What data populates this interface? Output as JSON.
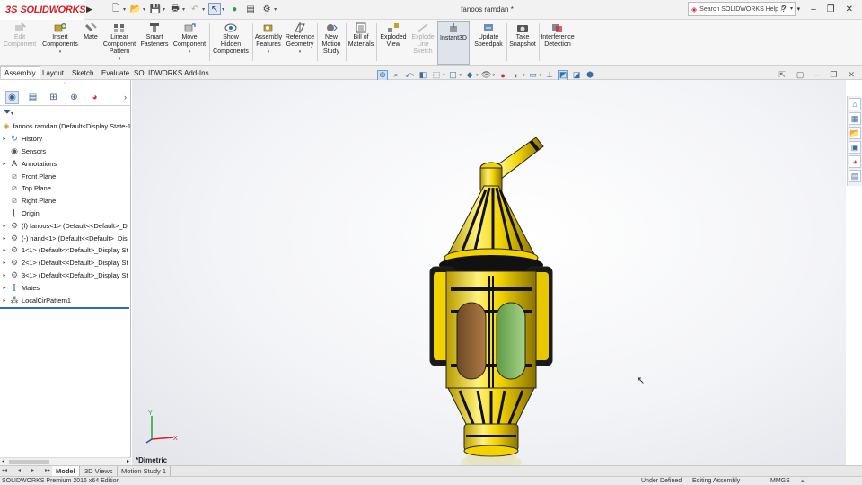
{
  "app": {
    "logo_ds": "3S",
    "logo_text": "SOLIDWORKS",
    "document_title": "fanoos ramdan *",
    "help_search_placeholder": "Search SOLIDWORKS Help"
  },
  "command_manager": [
    {
      "label": "Edit\nComponent",
      "enabled": false,
      "icon": "edit-component-icon"
    },
    {
      "label": "Insert\nComponents",
      "enabled": true,
      "icon": "insert-components-icon",
      "dropdown": true
    },
    {
      "label": "Mate",
      "enabled": true,
      "icon": "mate-icon"
    },
    {
      "label": "Linear\nComponent\nPattern",
      "enabled": true,
      "icon": "linear-pattern-icon",
      "dropdown": true
    },
    {
      "label": "Smart\nFasteners",
      "enabled": true,
      "icon": "smart-fasteners-icon"
    },
    {
      "label": "Move\nComponent",
      "enabled": true,
      "icon": "move-component-icon",
      "dropdown": true
    },
    {
      "label": "Show\nHidden\nComponents",
      "enabled": true,
      "icon": "show-hidden-icon"
    },
    {
      "label": "Assembly\nFeatures",
      "enabled": true,
      "icon": "assembly-features-icon",
      "dropdown": true
    },
    {
      "label": "Reference\nGeometry",
      "enabled": true,
      "icon": "reference-geometry-icon",
      "dropdown": true
    },
    {
      "label": "New\nMotion\nStudy",
      "enabled": true,
      "icon": "motion-study-icon"
    },
    {
      "label": "Bill of\nMaterials",
      "enabled": true,
      "icon": "bom-icon"
    },
    {
      "label": "Exploded\nView",
      "enabled": true,
      "icon": "exploded-view-icon"
    },
    {
      "label": "Explode\nLine\nSketch",
      "enabled": false,
      "icon": "explode-line-icon"
    },
    {
      "label": "Instant3D",
      "enabled": true,
      "icon": "instant3d-icon",
      "active": true
    },
    {
      "label": "Update\nSpeedpak",
      "enabled": true,
      "icon": "speedpak-icon"
    },
    {
      "label": "Take\nSnapshot",
      "enabled": true,
      "icon": "camera-icon"
    },
    {
      "label": "Interference\nDetection",
      "enabled": true,
      "icon": "interference-icon"
    }
  ],
  "tabs": [
    "Assembly",
    "Layout",
    "Sketch",
    "Evaluate",
    "SOLIDWORKS Add-Ins"
  ],
  "active_tab": "Assembly",
  "tree": {
    "root": "fanoos ramdan  (Default<Display State-1",
    "items": [
      {
        "label": "History",
        "icon": "history-icon",
        "expandable": true
      },
      {
        "label": "Sensors",
        "icon": "sensors-icon",
        "expandable": false
      },
      {
        "label": "Annotations",
        "icon": "annotations-icon",
        "expandable": true
      },
      {
        "label": "Front Plane",
        "icon": "plane-icon",
        "expandable": false
      },
      {
        "label": "Top Plane",
        "icon": "plane-icon",
        "expandable": false
      },
      {
        "label": "Right Plane",
        "icon": "plane-icon",
        "expandable": false
      },
      {
        "label": "Origin",
        "icon": "origin-icon",
        "expandable": false
      },
      {
        "label": "(f) fanoos<1> (Default<<Default>_D",
        "icon": "part-icon",
        "expandable": true
      },
      {
        "label": "(-) hand<1> (Default<<Default>_Dis",
        "icon": "part-icon",
        "expandable": true
      },
      {
        "label": "1<1> (Default<<Default>_Display St",
        "icon": "part-icon",
        "expandable": true
      },
      {
        "label": "2<1> (Default<<Default>_Display St",
        "icon": "part-icon",
        "expandable": true
      },
      {
        "label": "3<1> (Default<<Default>_Display St",
        "icon": "part-icon",
        "expandable": true
      },
      {
        "label": "Mates",
        "icon": "mates-icon",
        "expandable": true
      },
      {
        "label": "LocalCirPattern1",
        "icon": "pattern-icon",
        "expandable": true
      }
    ]
  },
  "viewport": {
    "view_name": "*Dimetric",
    "triad": {
      "x": "X",
      "y": "Y"
    }
  },
  "bottom_tabs": [
    "Model",
    "3D Views",
    "Motion Study 1"
  ],
  "active_bottom_tab": "Model",
  "status": {
    "edition": "SOLIDWORKS Premium 2016 x64 Edition",
    "defined": "Under Defined",
    "mode": "Editing Assembly",
    "units": "MMGS"
  },
  "colors": {
    "brand": "#d71f26",
    "gold": "#f2d300",
    "black": "#111111",
    "glass_green": "#7ab05a",
    "glass_brown": "#9a6a3a",
    "selection_blue": "#2e6bc7"
  }
}
